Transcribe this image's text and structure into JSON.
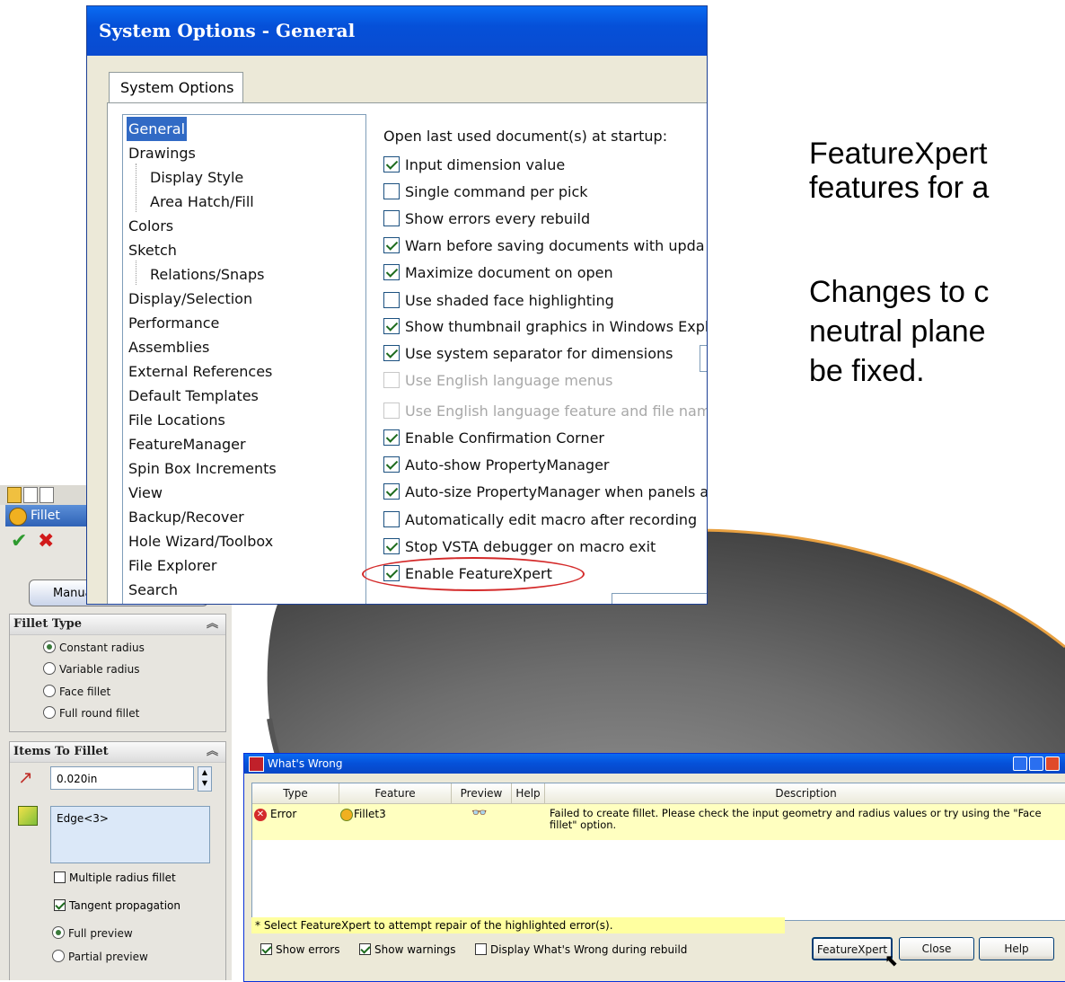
{
  "slide": {
    "line1": "FeatureXpert",
    "line2": "features for a",
    "line3": "Changes to c",
    "line4": "neutral plane",
    "line5": "be fixed."
  },
  "property_manager": {
    "feature_name": "Fillet",
    "manual_tab": "Manua",
    "fillet_type": {
      "header": "Fillet Type",
      "options": [
        "Constant radius",
        "Variable radius",
        "Face fillet",
        "Full round fillet"
      ],
      "selected": "Constant radius"
    },
    "items_to_fillet": {
      "header": "Items To Fillet",
      "radius_value": "0.020in",
      "edge_list": [
        "Edge<3>"
      ],
      "multiple_radius_label": "Multiple radius fillet",
      "multiple_radius_checked": false,
      "tangent_propagation_label": "Tangent propagation",
      "tangent_propagation_checked": true,
      "preview_options": [
        "Full preview",
        "Partial preview"
      ],
      "preview_selected": "Full preview"
    },
    "colors": {
      "ok": "#2e9a2e",
      "cancel": "#d11a1a"
    }
  },
  "system_options": {
    "title": "System Options - General",
    "tab": "System Options",
    "tree_items": [
      {
        "label": "General",
        "selected": true,
        "sub": false
      },
      {
        "label": "Drawings",
        "sub": false
      },
      {
        "label": "Display Style",
        "sub": true
      },
      {
        "label": "Area Hatch/Fill",
        "sub": true
      },
      {
        "label": "Colors",
        "sub": false
      },
      {
        "label": "Sketch",
        "sub": false
      },
      {
        "label": "Relations/Snaps",
        "sub": true
      },
      {
        "label": "Display/Selection",
        "sub": false
      },
      {
        "label": "Performance",
        "sub": false
      },
      {
        "label": "Assemblies",
        "sub": false
      },
      {
        "label": "External References",
        "sub": false
      },
      {
        "label": "Default Templates",
        "sub": false
      },
      {
        "label": "File Locations",
        "sub": false
      },
      {
        "label": "FeatureManager",
        "sub": false
      },
      {
        "label": "Spin Box Increments",
        "sub": false
      },
      {
        "label": "View",
        "sub": false
      },
      {
        "label": "Backup/Recover",
        "sub": false
      },
      {
        "label": "Hole Wizard/Toolbox",
        "sub": false
      },
      {
        "label": "File Explorer",
        "sub": false
      },
      {
        "label": "Search",
        "sub": false
      }
    ],
    "open_last_label": "Open last used document(s) at startup:",
    "options": [
      {
        "label": "Input dimension value",
        "checked": true
      },
      {
        "label": "Single command per pick",
        "checked": false
      },
      {
        "label": "Show errors every rebuild",
        "checked": false
      },
      {
        "label": "Warn before saving documents with upda",
        "checked": true
      },
      {
        "label": "Maximize document on open",
        "checked": true
      },
      {
        "label": "Use shaded face highlighting",
        "checked": false
      },
      {
        "label": "Show thumbnail graphics in Windows Explo",
        "checked": true
      },
      {
        "label": "Use system separator for dimensions",
        "checked": true
      },
      {
        "label": "Use English language menus",
        "checked": false,
        "disabled": true
      },
      {
        "label": "Use English language feature and file nam",
        "checked": false,
        "disabled": true
      },
      {
        "label": "Enable Confirmation Corner",
        "checked": true
      },
      {
        "label": "Auto-show PropertyManager",
        "checked": true
      },
      {
        "label": "Auto-size PropertyManager when panels a",
        "checked": true
      },
      {
        "label": "Automatically edit macro after recording",
        "checked": false
      },
      {
        "label": "Stop VSTA debugger on macro exit",
        "checked": true
      },
      {
        "label": "Enable FeatureXpert",
        "checked": true,
        "highlighted": true
      }
    ],
    "highlight_color": "#d42a2a"
  },
  "whats_wrong": {
    "title": "What's Wrong",
    "columns": [
      "Type",
      "Feature",
      "Preview",
      "Help",
      "Description"
    ],
    "rows": [
      {
        "type": "Error",
        "feature": "Fillet3",
        "description": "Failed to create fillet.  Please check the input geometry and radius values or try using the \"Face fillet\" option."
      }
    ],
    "hint": "* Select FeatureXpert to attempt repair of the highlighted error(s).",
    "show_errors_label": "Show errors",
    "show_errors_checked": true,
    "show_warnings_label": "Show warnings",
    "show_warnings_checked": true,
    "display_during_rebuild_label": "Display What's Wrong during rebuild",
    "display_during_rebuild_checked": false,
    "buttons": {
      "featurexpert": "FeatureXpert",
      "close": "Close",
      "help": "Help"
    },
    "hint_color": "#ffffa0"
  }
}
